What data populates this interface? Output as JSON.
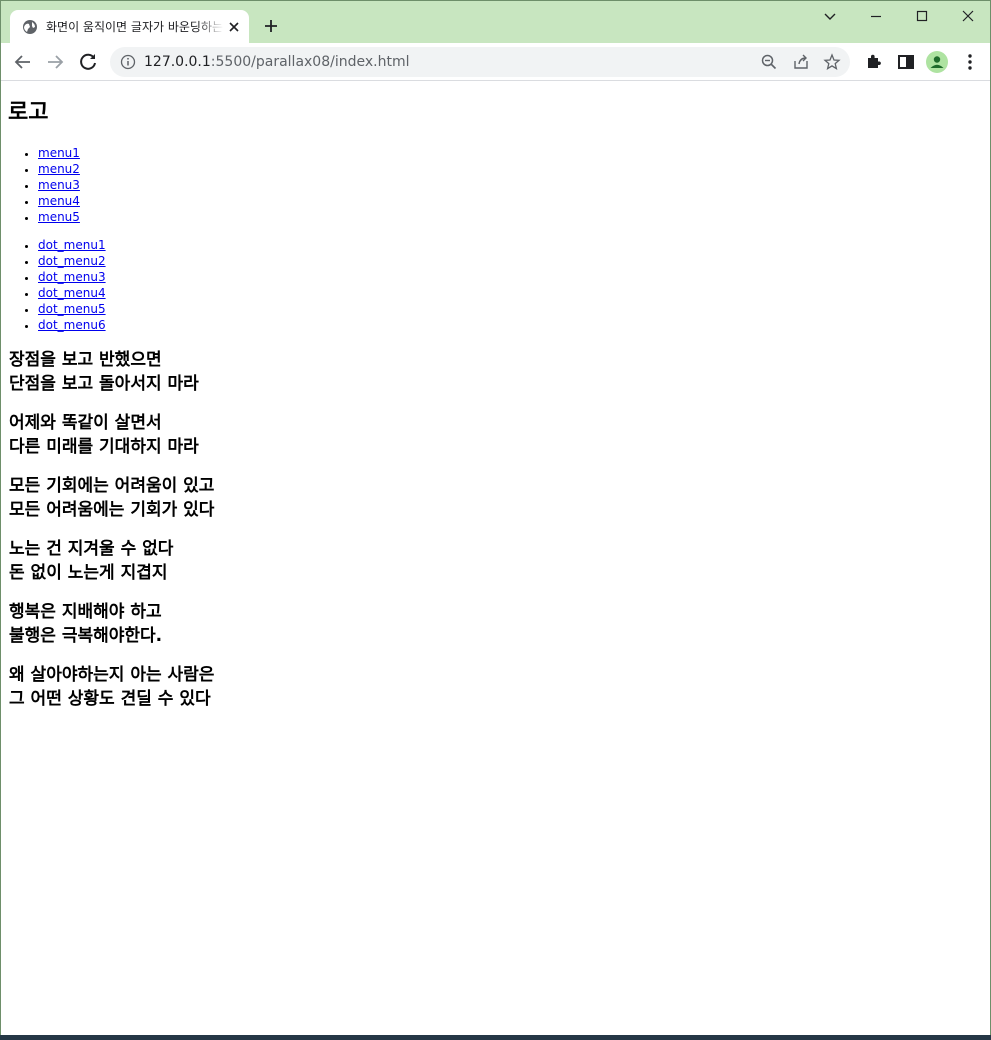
{
  "tab": {
    "title": "화면이 움직이면 글자가 바운딩하는 효과",
    "favicon": "globe-icon"
  },
  "toolbar": {
    "url_host": "127.0.0.1",
    "url_rest": ":5500/parallax08/index.html"
  },
  "page": {
    "logo": "로고",
    "menu": [
      {
        "label": "menu1"
      },
      {
        "label": "menu2"
      },
      {
        "label": "menu3"
      },
      {
        "label": "menu4"
      },
      {
        "label": "menu5"
      }
    ],
    "dot_menu": [
      {
        "label": "dot_menu1"
      },
      {
        "label": "dot_menu2"
      },
      {
        "label": "dot_menu3"
      },
      {
        "label": "dot_menu4"
      },
      {
        "label": "dot_menu5"
      },
      {
        "label": "dot_menu6"
      }
    ],
    "quotes": [
      {
        "line1": "장점을 보고 반했으면",
        "line2": "단점을 보고 돌아서지 마라"
      },
      {
        "line1": "어제와 똑같이 살면서",
        "line2": "다른 미래를 기대하지 마라"
      },
      {
        "line1": "모든 기회에는 어려움이 있고",
        "line2": "모든 어려움에는 기회가 있다"
      },
      {
        "line1": "노는 건 지겨울 수 없다",
        "line2": "돈 없이 노는게 지겹지"
      },
      {
        "line1": "행복은 지배해야 하고",
        "line2": "불행은 극복해야한다."
      },
      {
        "line1": "왜 살아야하는지 아는 사람은",
        "line2": "그 어떤 상황도 견딜 수 있다"
      }
    ]
  },
  "colors": {
    "tabstrip": "#c8e6c0",
    "link": "#0000ee",
    "profile": "#aee3a1"
  }
}
